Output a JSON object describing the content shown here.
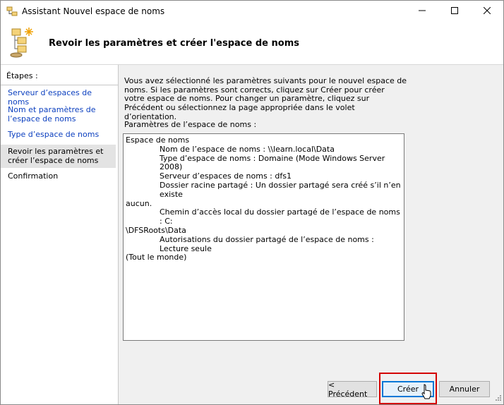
{
  "window": {
    "title": "Assistant Nouvel espace de noms",
    "icons": {
      "app": "folder-tree-icon",
      "minimize": "minimize-icon",
      "maximize": "maximize-icon",
      "close": "close-icon"
    }
  },
  "header": {
    "title": "Revoir les paramètres et créer l'espace de noms",
    "icon": "namespace-wizard-icon"
  },
  "sidebar": {
    "title": "Étapes :",
    "steps": [
      {
        "label": "Serveur d’espaces de noms",
        "state": "link"
      },
      {
        "label": "Nom et paramètres de l’espace de noms",
        "state": "link"
      },
      {
        "label": "Type d’espace de noms",
        "state": "link"
      },
      {
        "label": "Revoir les paramètres et créer l’espace de noms",
        "state": "current"
      },
      {
        "label": "Confirmation",
        "state": "disabled"
      }
    ]
  },
  "content": {
    "intro": "Vous avez sélectionné les paramètres suivants pour le nouvel espace de noms. Si les paramètres sont corrects, cliquez sur Créer pour créer votre espace de noms. Pour changer un paramètre, cliquez sur Précédent ou sélectionnez la page appropriée dans le volet d’orientation.",
    "params_label": "Paramètres de l’espace de noms :",
    "params": {
      "heading": "Espace de noms",
      "name": "Nom de l’espace de noms : \\\\learn.local\\Data",
      "type": "Type d’espace de noms : Domaine (Mode Windows Server 2008)",
      "server": "Serveur d’espaces de noms : dfs1",
      "root_line1": "Dossier racine partagé : Un dossier partagé sera créé s’il n’en existe",
      "root_line2": "aucun.",
      "path_line1": "Chemin d’accès local du dossier partagé de l’espace de noms : C:",
      "path_line2": "\\DFSRoots\\Data",
      "perm_line1": "Autorisations du dossier partagé de l’espace de noms : Lecture seule",
      "perm_line2": "(Tout le monde)"
    }
  },
  "buttons": {
    "previous": "< Précédent",
    "create": "Créer",
    "cancel": "Annuler"
  },
  "colors": {
    "link": "#0b3fbf",
    "highlight_box": "#d40000",
    "default_button_border": "#0078d7"
  }
}
